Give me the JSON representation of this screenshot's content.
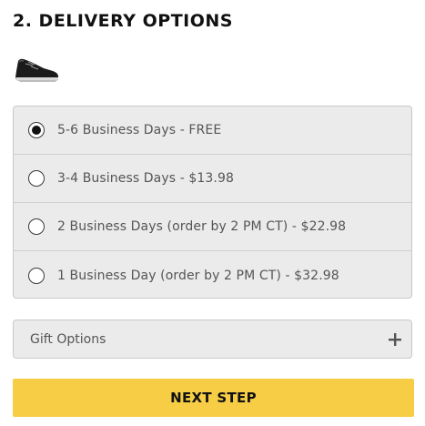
{
  "section": {
    "title": "2. DELIVERY OPTIONS"
  },
  "product": {
    "thumbnail_icon": "sneaker-thumbnail"
  },
  "delivery": {
    "selected_index": 0,
    "options": [
      {
        "label": "5-6 Business Days - FREE"
      },
      {
        "label": "3-4 Business Days - $13.98"
      },
      {
        "label": "2 Business Days (order by 2 PM CT) - $22.98"
      },
      {
        "label": "1 Business Day (order by 2 PM CT) - $32.98"
      }
    ]
  },
  "gift": {
    "label": "Gift Options",
    "icon": "plus-icon"
  },
  "actions": {
    "next_label": "NEXT STEP"
  },
  "colors": {
    "accent": "#f6cd45",
    "panel_bg": "#ebebeb",
    "text_muted": "#555555"
  }
}
